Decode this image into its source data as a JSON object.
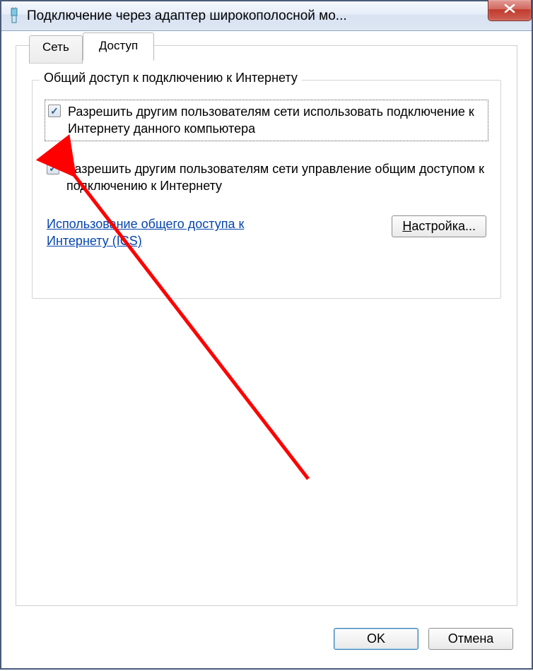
{
  "window": {
    "title": "Подключение через адаптер широкополосной мо..."
  },
  "tabs": {
    "network": "Сеть",
    "access": "Доступ"
  },
  "group": {
    "title": "Общий доступ к подключению к Интернету",
    "check1": {
      "checked": true,
      "label": "Разрешить другим пользователям сети использовать подключение к Интернету данного компьютера"
    },
    "check2": {
      "checked": true,
      "label": "Разрешить другим пользователям сети управление общим доступом к подключению к Интернету"
    },
    "link": "Использование общего доступа к Интернету (ICS)",
    "settings_btn_prefix": "Н",
    "settings_btn_rest": "астройка..."
  },
  "footer": {
    "ok": "OK",
    "cancel": "Отмена"
  }
}
